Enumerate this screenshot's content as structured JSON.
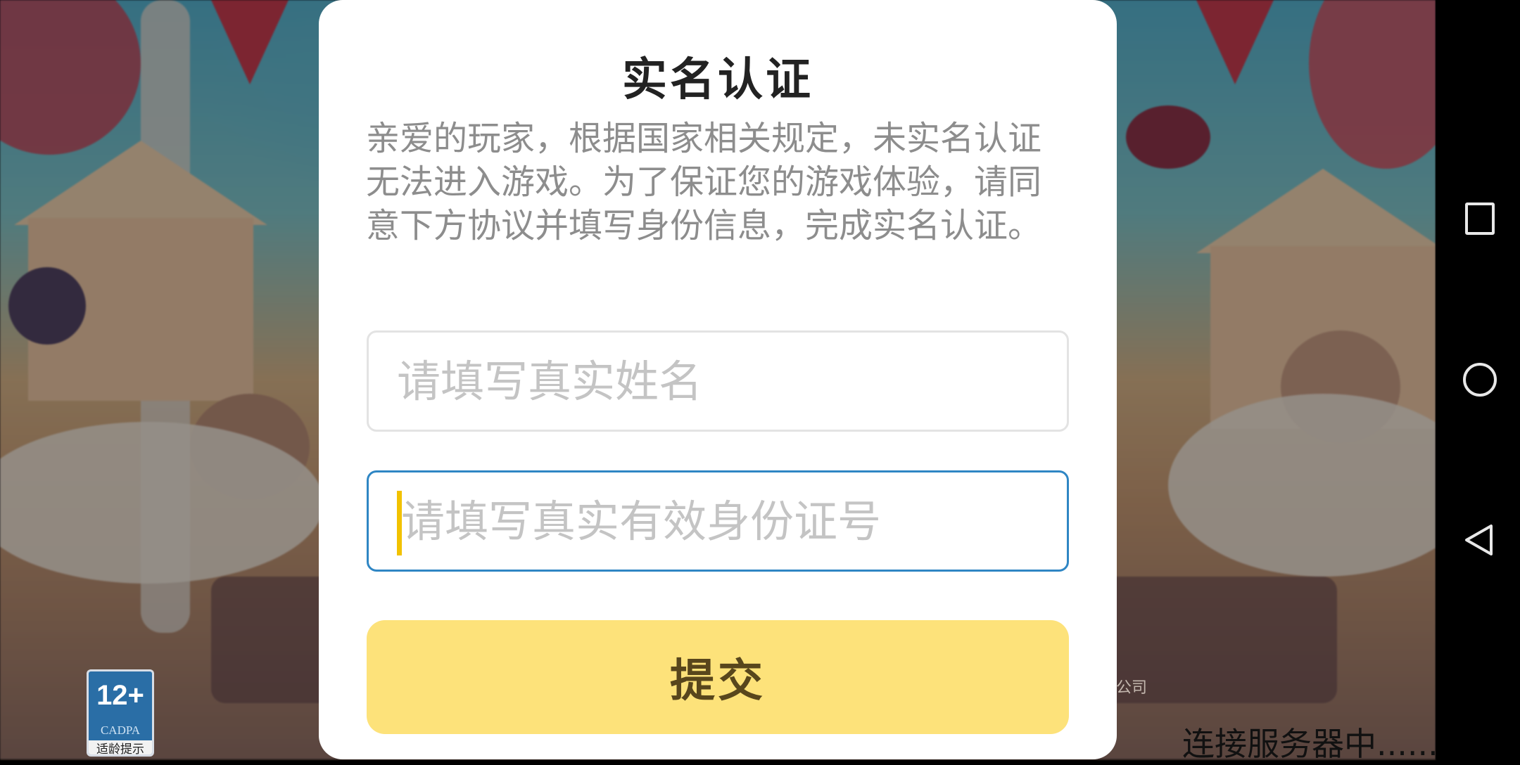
{
  "dialog": {
    "title": "实名认证",
    "description": "亲爱的玩家，根据国家相关规定，未实名认证无法进入游戏。为了保证您的游戏体验，请同意下方协议并填写身份信息，完成实名认证。",
    "name_field": {
      "placeholder": "请填写真实姓名",
      "value": ""
    },
    "id_field": {
      "placeholder": "请填写真实有效身份证号",
      "value": ""
    },
    "submit_label": "提交"
  },
  "age_rating": {
    "number": "12+",
    "org": "CADPA",
    "caption": "适龄提示"
  },
  "background": {
    "company_fragment": "公司",
    "status_text": "连接服务器中......"
  },
  "navigation": {
    "icons": [
      "recent-apps-icon",
      "home-icon",
      "back-icon"
    ]
  },
  "colors": {
    "submit_button": "#fde27a",
    "focused_border": "#2f86c4",
    "caret": "#f2c200"
  }
}
